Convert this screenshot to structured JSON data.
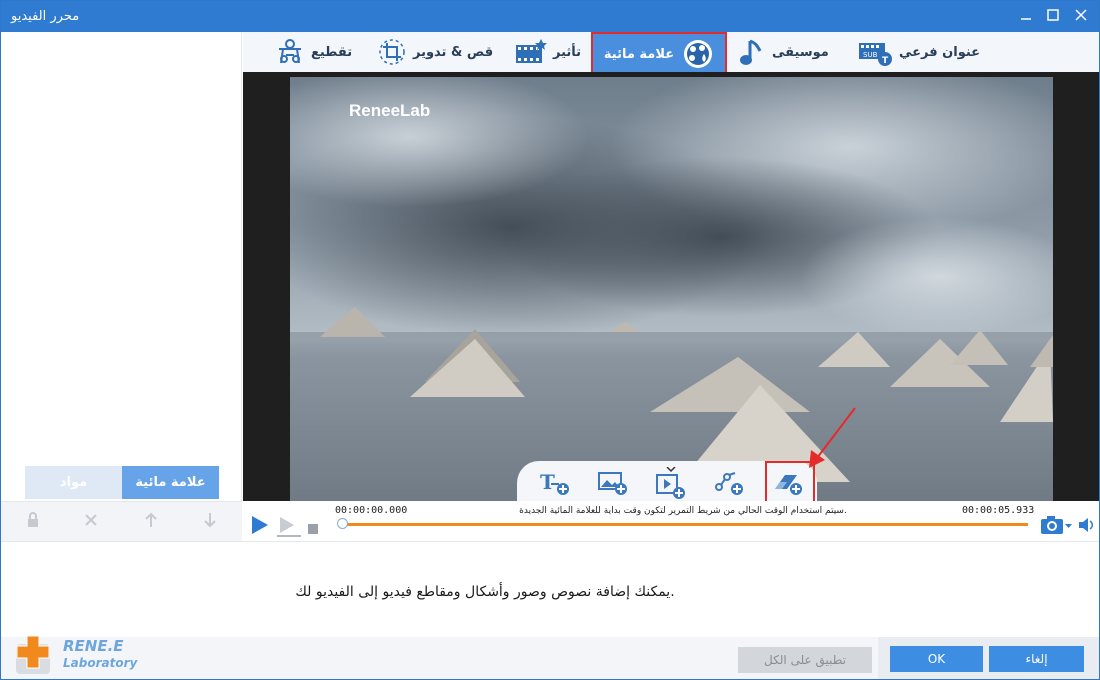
{
  "window": {
    "title": "محرر الفيديو"
  },
  "tabs": [
    {
      "label": "عنوان فرعي",
      "icon": "subtitle-icon"
    },
    {
      "label": "موسيقى",
      "icon": "music-note-icon"
    },
    {
      "label": "علامة مائية",
      "icon": "watermark-icon",
      "active": true
    },
    {
      "label": "تأثير",
      "icon": "effect-film-icon"
    },
    {
      "label": "قص & تدوير",
      "icon": "crop-rotate-icon"
    },
    {
      "label": "تقطيع",
      "icon": "cut-scissors-icon"
    }
  ],
  "preview": {
    "watermark_text": "ReneeLab"
  },
  "dock": {
    "tools": [
      "add-text-icon",
      "add-image-icon",
      "add-video-icon",
      "add-shape-icon",
      "add-watermark-eraser-icon"
    ]
  },
  "left_panel": {
    "tab_watermark": "علامة مائية",
    "tab_materials": "مواد"
  },
  "timeline": {
    "time_start": "00:00:00.000",
    "time_end": "00:00:05.933",
    "hint": "سيتم استخدام الوقت الحالي من شريط التمرير لتكون وقت بداية للعلامة المائية الجديدة.",
    "progress": 1.0,
    "position": 0.0
  },
  "info": {
    "text": "يمكنك إضافة نصوص وصور وأشكال ومقاطع فيديو إلى الفيديو لك."
  },
  "footer": {
    "apply_all": "تطبيق على الكل",
    "ok": "OK",
    "cancel": "إلغاء",
    "logo_line1": "RENE.E",
    "logo_line2": "Laboratory"
  },
  "colors": {
    "accent": "#3d8ee2",
    "titlebar": "#2f7bd1",
    "highlight": "#e52a2a",
    "progress": "#f08a1e"
  }
}
